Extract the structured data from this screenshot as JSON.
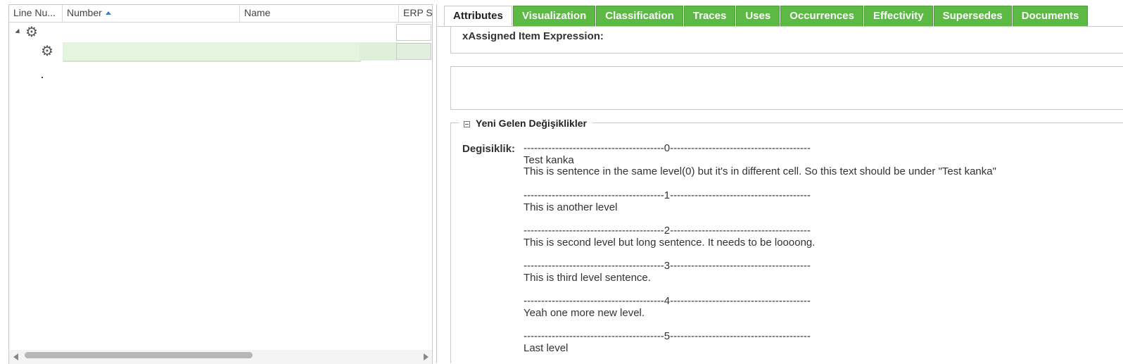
{
  "grid": {
    "columns": [
      {
        "label": "Line Nu..."
      },
      {
        "label": "Number",
        "sorted": "ascending"
      },
      {
        "label": "Name"
      },
      {
        "label": "ERP S"
      }
    ],
    "rows": [
      {
        "icon": "gear-icon",
        "expanded": true
      },
      {
        "icon": "gear-icon",
        "selected": true
      }
    ]
  },
  "tabs": [
    {
      "label": "Attributes",
      "active": true
    },
    {
      "label": "Visualization"
    },
    {
      "label": "Classification"
    },
    {
      "label": "Traces"
    },
    {
      "label": "Uses"
    },
    {
      "label": "Occurrences"
    },
    {
      "label": "Effectivity"
    },
    {
      "label": "Supersedes"
    },
    {
      "label": "Documents"
    }
  ],
  "attributes": {
    "assigned_expression_label": "xAssigned Item Expression:",
    "section_title": "Yeni Gelen Değişiklikler",
    "degisiklik_label": "Degisiklik:",
    "degisiklik_value": "----------------------------------------0----------------------------------------\nTest kanka\nThis is sentence in the same level(0) but it's in different cell. So this text should be under \"Test kanka\"\n\n----------------------------------------1----------------------------------------\nThis is another level\n\n----------------------------------------2----------------------------------------\nThis is second level but long sentence. It needs to be loooong.\n\n----------------------------------------3----------------------------------------\nThis is third level sentence.\n\n----------------------------------------4----------------------------------------\nYeah one more new level.\n\n----------------------------------------5----------------------------------------\nLast level"
  },
  "colors": {
    "tab_green": "#5cb944",
    "selection": "#e3f4df",
    "sort_arrow": "#3b7dc4"
  }
}
